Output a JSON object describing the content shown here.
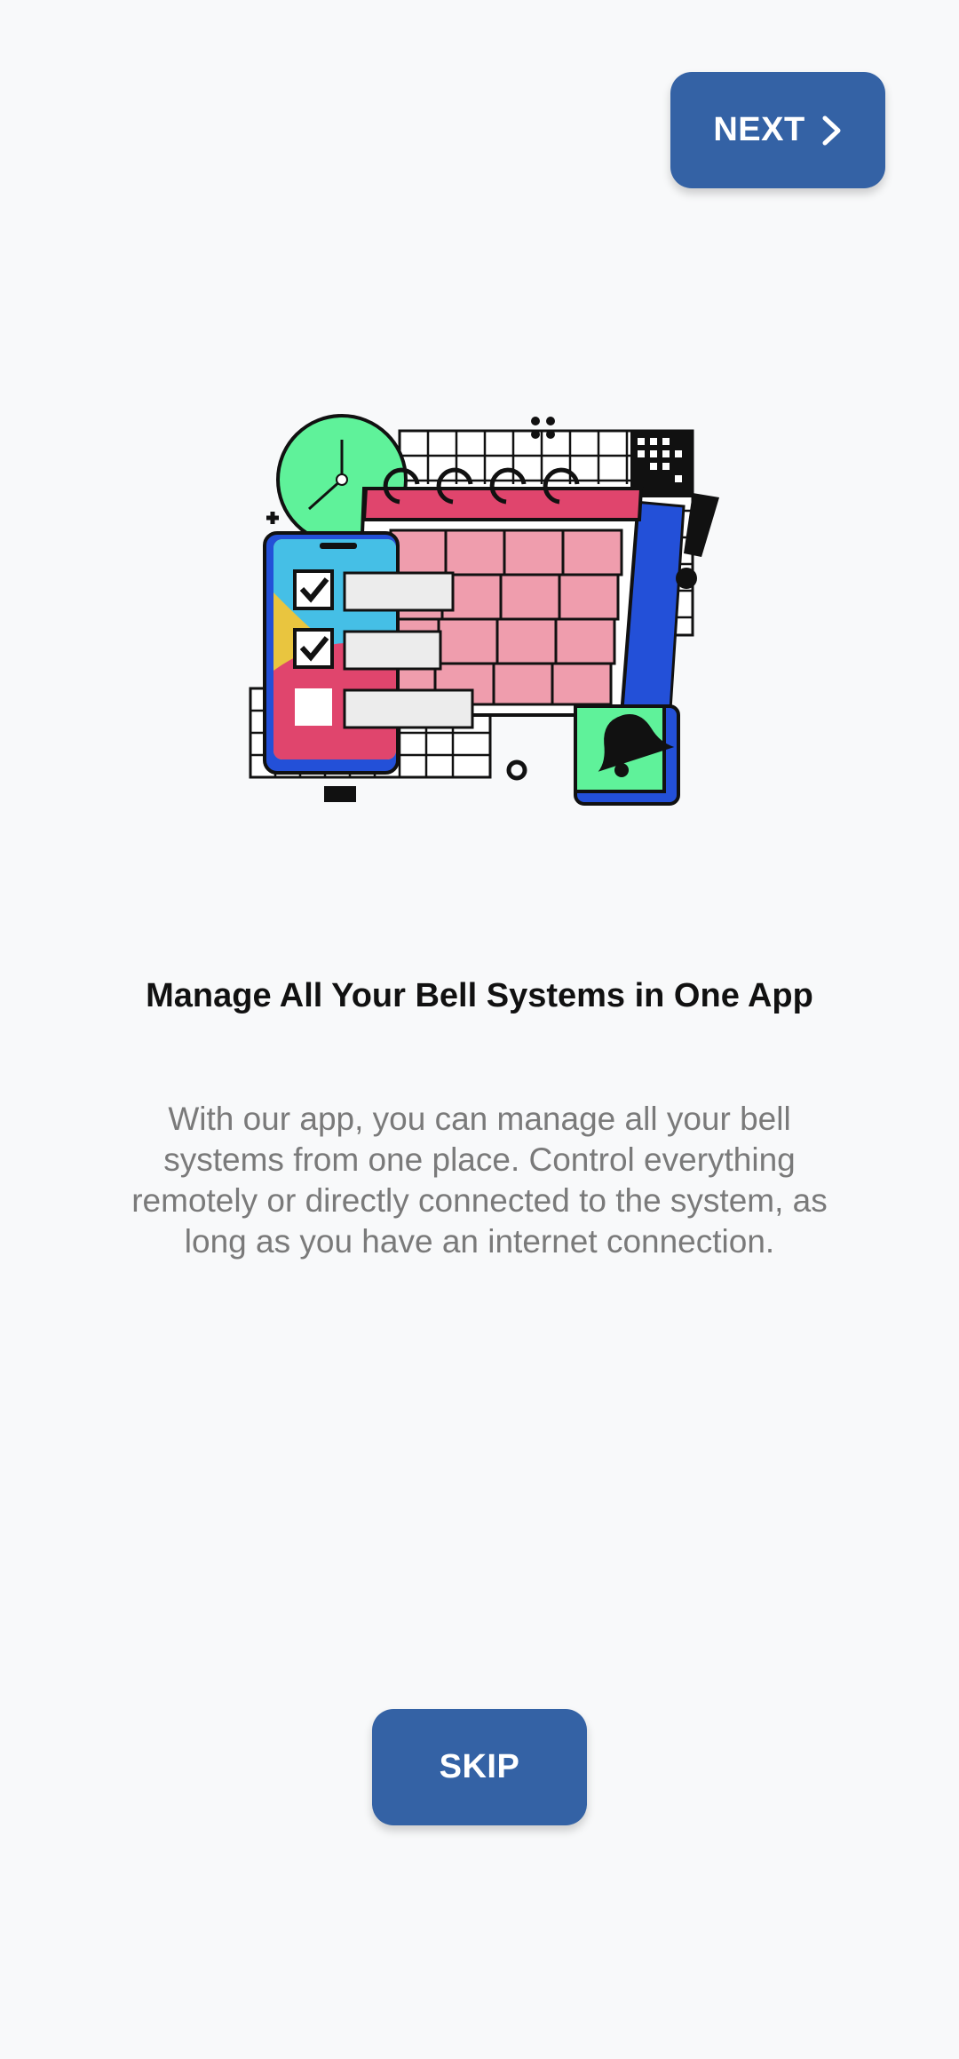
{
  "header": {
    "next_label": "NEXT"
  },
  "illustration": {
    "icon": "calendar-schedule-illustration"
  },
  "onboarding": {
    "title": "Manage All Your Bell Systems in One App",
    "description": "With our app, you can manage all your bell systems from one place. Control everything remotely or directly connected to the system, as long as you have an internet connection."
  },
  "footer": {
    "skip_label": "SKIP"
  },
  "colors": {
    "button": "#3462a5",
    "background": "#f8f9fa"
  }
}
